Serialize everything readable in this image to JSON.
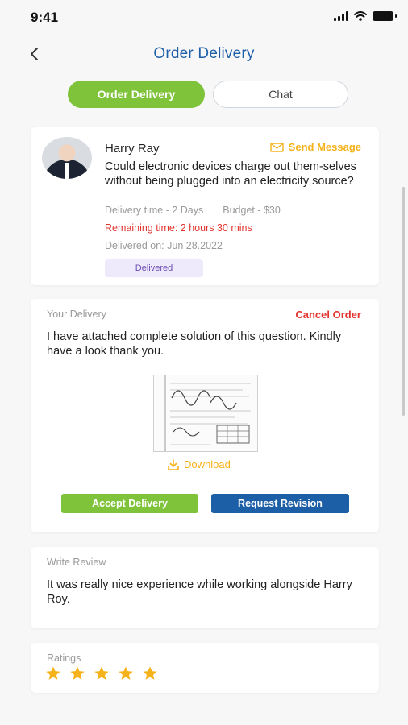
{
  "status_bar": {
    "time": "9:41"
  },
  "header": {
    "title": "Order Delivery"
  },
  "tabs": [
    {
      "label": "Order Delivery",
      "active": true
    },
    {
      "label": "Chat",
      "active": false
    }
  ],
  "order": {
    "name": "Harry Ray",
    "send_message": "Send Message",
    "question": "Could electronic devices charge out them-selves without being plugged into an electricity source?",
    "delivery_time": "Delivery time - 2 Days",
    "budget": "Budget - $30",
    "remaining_time": "Remaining time: 2 hours 30 mins",
    "delivered_on": "Delivered on: Jun 28.2022",
    "status": "Delivered"
  },
  "delivery": {
    "label": "Your Delivery",
    "cancel": "Cancel Order",
    "message": "I have attached complete solution of this question. Kindly have a look thank you.",
    "download": "Download",
    "accept": "Accept Delivery",
    "revision": "Request Revision"
  },
  "review": {
    "label": "Write Review",
    "text": "It was really nice experience while working alongside Harry Roy."
  },
  "ratings": {
    "label": "Ratings",
    "value": 5,
    "max": 5
  },
  "colors": {
    "primary_green": "#7fc33a",
    "primary_blue": "#1d5fa6",
    "accent_yellow": "#f6b21a",
    "danger_red": "#e3342f",
    "badge_purple": "#6a4bb3"
  },
  "icons": [
    "back-arrow-icon",
    "envelope-icon",
    "download-icon",
    "star-icon",
    "signal-icon",
    "wifi-icon",
    "battery-icon"
  ]
}
